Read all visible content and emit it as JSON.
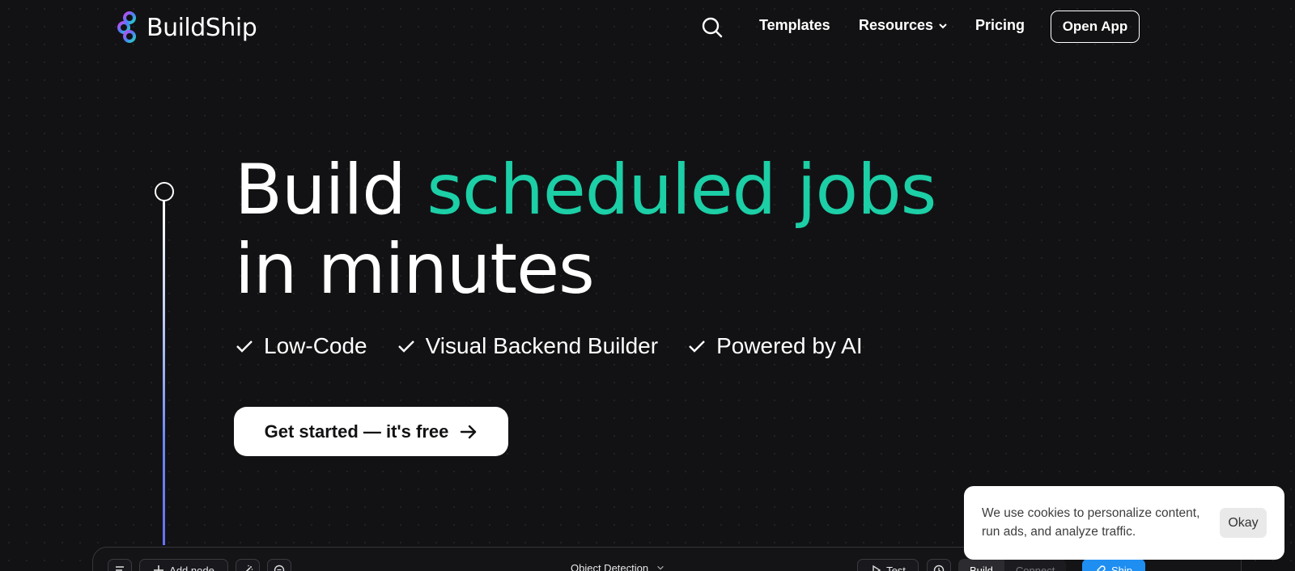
{
  "nav": {
    "brand": "BuildShip",
    "links": [
      "Templates",
      "Resources",
      "Pricing"
    ],
    "open_app_label": "Open App"
  },
  "hero": {
    "headline_prefix": "Build",
    "headline_accent": "scheduled jobs",
    "headline_line2": "in minutes",
    "features": [
      "Low-Code",
      "Visual Backend Builder",
      "Powered by AI"
    ],
    "cta_label": "Get started — it's free"
  },
  "editor": {
    "add_node_label": "Add node",
    "workflow_title": "Object Detection",
    "test_label": "Test",
    "tabs": [
      "Build",
      "Connect"
    ],
    "ship_label": "Ship"
  },
  "cookie": {
    "message": "We use cookies to personalize content, run ads, and analyze traffic.",
    "okay_label": "Okay"
  },
  "colors": {
    "background": "#121214",
    "accent": "#1ccfa6",
    "ship_blue": "#1f8ef1"
  }
}
